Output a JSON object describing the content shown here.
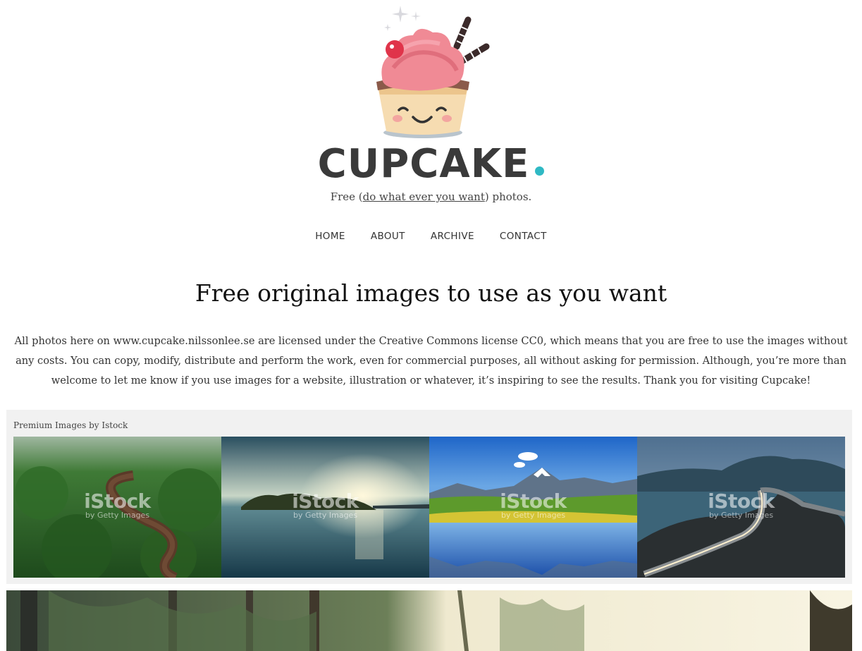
{
  "site": {
    "name": "CUPCAKE",
    "tagline_prefix": "Free (",
    "tagline_link": "do what ever you want",
    "tagline_suffix": ") photos."
  },
  "nav": {
    "items": [
      {
        "label": "HOME"
      },
      {
        "label": "ABOUT"
      },
      {
        "label": "ARCHIVE"
      },
      {
        "label": "CONTACT"
      }
    ]
  },
  "main": {
    "headline": "Free original images to use as you want",
    "intro": "All photos here on www.cupcake.nilssonlee.se are licensed under the Creative Commons license CC0, which means that you are free to use the images without any costs. You can copy, modify, distribute and perform the work, even for commercial purposes, all without asking for permission. Although, you’re more than welcome to let me know if you use images for a website, illustration or whatever, it’s inspiring to see the results. Thank you for visiting Cupcake!"
  },
  "istock": {
    "label": "Premium Images by Istock",
    "watermark": "iStock",
    "watermark_sub": "by Getty Images",
    "thumbnails": [
      {
        "subject": "aerial forest river"
      },
      {
        "subject": "lake island sunset"
      },
      {
        "subject": "alpine lake reflection"
      },
      {
        "subject": "coastal road bridge"
      }
    ]
  },
  "colors": {
    "accent": "#2fb9c4",
    "text": "#333333",
    "panel_bg": "#f1f1f1"
  }
}
